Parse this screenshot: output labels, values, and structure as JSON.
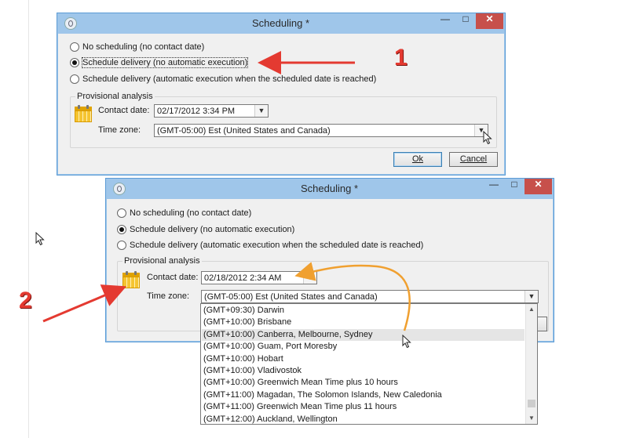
{
  "dialog1": {
    "title": "Scheduling *",
    "options": [
      "No scheduling (no contact date)",
      "Schedule delivery (no automatic execution)",
      "Schedule delivery (automatic execution when the scheduled date is reached)"
    ],
    "selected_index": 1,
    "group_title": "Provisional analysis",
    "contact_date_label": "Contact date:",
    "contact_date_value": "02/17/2012 3:34 PM",
    "time_zone_label": "Time zone:",
    "time_zone_value": "(GMT-05:00) Est (United States and Canada)",
    "ok_label": "Ok",
    "cancel_label": "Cancel"
  },
  "dialog2": {
    "title": "Scheduling *",
    "options": [
      "No scheduling (no contact date)",
      "Schedule delivery (no automatic execution)",
      "Schedule delivery (automatic execution when the scheduled date is reached)"
    ],
    "selected_index": 1,
    "group_title": "Provisional analysis",
    "contact_date_label": "Contact date:",
    "contact_date_value": "02/18/2012 2:34 AM",
    "time_zone_label": "Time zone:",
    "time_zone_value": "(GMT-05:00) Est (United States and Canada)",
    "dropdown_items": [
      "(GMT+09:30) Darwin",
      "(GMT+10:00) Brisbane",
      "(GMT+10:00) Canberra, Melbourne, Sydney",
      "(GMT+10:00) Guam, Port Moresby",
      "(GMT+10:00) Hobart",
      "(GMT+10:00) Vladivostok",
      "(GMT+10:00) Greenwich Mean Time plus 10 hours",
      "(GMT+11:00) Magadan, The Solomon Islands, New Caledonia",
      "(GMT+11:00) Greenwich Mean Time plus 11 hours",
      "(GMT+12:00) Auckland, Wellington"
    ],
    "highlighted_index": 2
  },
  "window_buttons": {
    "minimize": "—",
    "maximize": "□",
    "close": "✕"
  },
  "annotations": {
    "step1": "1",
    "step2": "2"
  },
  "colors": {
    "accent_arrow": "#e43a31",
    "curve_arrow": "#f0a030",
    "titlebar": "#9fc6ea"
  }
}
